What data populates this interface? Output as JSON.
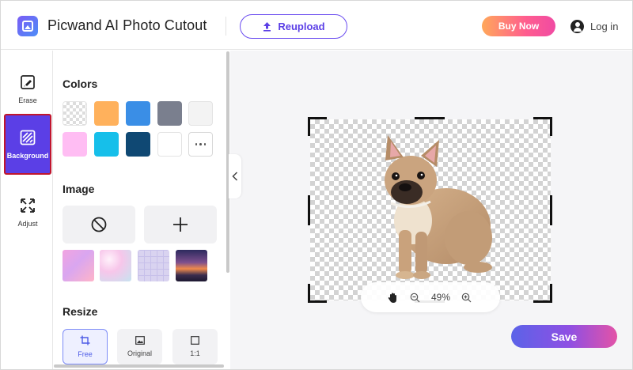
{
  "header": {
    "app_title": "Picwand AI Photo Cutout",
    "reupload_label": "Reupload",
    "buy_label": "Buy Now",
    "login_label": "Log in"
  },
  "tools": {
    "erase_label": "Erase",
    "background_label": "Background",
    "adjust_label": "Adjust",
    "active": "Background"
  },
  "panel": {
    "colors_title": "Colors",
    "colors": [
      "transparent",
      "#FFB15C",
      "#3A8EE6",
      "#7A7F8E",
      "#F3F3F3",
      "#FFBDF3",
      "#16BFEA",
      "#0F4873",
      "#FFFFFF",
      "more"
    ],
    "image_title": "Image",
    "image_buttons": [
      "none-icon",
      "add-icon"
    ],
    "image_thumbs": [
      "pink-purple gradient",
      "pastel pink bokeh",
      "lavender grid",
      "sunset sky"
    ],
    "resize_title": "Resize",
    "resize_options": [
      {
        "label": "Free",
        "active": true
      },
      {
        "label": "Original",
        "active": false
      },
      {
        "label": "1:1",
        "active": false
      }
    ]
  },
  "canvas": {
    "zoom_text": "49%"
  },
  "actions": {
    "save_label": "Save"
  },
  "colors": {
    "accent": "#5B3FE6",
    "canvas_bg": "#F5F5F7"
  }
}
